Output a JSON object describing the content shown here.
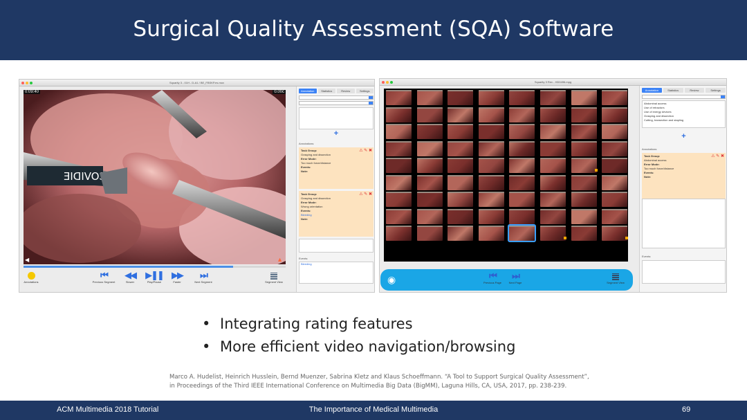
{
  "slide": {
    "title": "Surgical Quality Assessment (SQA) Software",
    "bullets": [
      "Integrating rating features",
      "More efficient video navigation/browsing"
    ],
    "citation_line1": "Marco A. Hudelist, Heinrich Husslein, Bernd Muenzer, Sabrina Kletz and Klaus Schoeffmann. “A Tool to Support Surgical Quality Assessment”,",
    "citation_line2": "in Proceedings of the Third IEEE International Conference on Multimedia Big Data (BigMM), Laguna Hills, CA, USA, 2017, pp. 238-239."
  },
  "footer": {
    "left": "ACM Multimedia 2018 Tutorial",
    "center": "The Importance of Medical Multimedia",
    "page": "69"
  },
  "left_app": {
    "window_title": "Squarity 3 - 01H - D-A1 / BE_FBSKP.es.mov",
    "time_elapsed": "0:09:40",
    "time_right": "0.00c",
    "tabs": [
      "Annotation",
      "Statistics",
      "Review",
      "Settings"
    ],
    "annotations_label": "Annotations:",
    "annotation_1": {
      "task": "Task Group:",
      "task_val": "Grasping and dissection",
      "error": "Error Mode:",
      "error_val": "Too much force/distance",
      "events": "Events:",
      "note": "Note:"
    },
    "annotation_2": {
      "task": "Task Group:",
      "task_val": "Grasping and dissection",
      "error": "Error Mode:",
      "error_val": "Wrong orientation",
      "events": "Events:",
      "events_val": "Bleeding",
      "note": "Note:"
    },
    "events_label": "Events:",
    "events_item": "Bleeding",
    "controls": [
      {
        "label": "Previous Segment",
        "icon": "⏮"
      },
      {
        "label": "Slower",
        "icon": "◀◀"
      },
      {
        "label": "Play/Pause",
        "icon": "▶❚❚"
      },
      {
        "label": "Faster",
        "icon": "▶▶"
      },
      {
        "label": "Next Segment",
        "icon": "⏭"
      }
    ],
    "annotations_button": "Annotations",
    "segment_view": "Segment View",
    "logo_text": "COVIDIE"
  },
  "right_app": {
    "window_title": "Squarity 3 Rev - HD0496.mpg",
    "tabs": [
      "Annotation",
      "Statistics",
      "Review",
      "Settings"
    ],
    "dropdown_items": [
      "Abdominal access",
      "Use of retractors",
      "Use of energy devices",
      "Grasping and dissection",
      "Cutting, transection and stapling"
    ],
    "annotations_label": "Annotations:",
    "annotation_1": {
      "task": "Task Group:",
      "task_val": "Abdominal access",
      "error": "Error Mode:",
      "error_val": "Too much force/distance",
      "events": "Events:",
      "note": "Note:"
    },
    "events_label": "Events:",
    "nav": [
      {
        "label": "Previous Page",
        "icon": "⏮"
      },
      {
        "label": "Next Page",
        "icon": "⏭"
      }
    ],
    "segment_view": "Segment View"
  }
}
